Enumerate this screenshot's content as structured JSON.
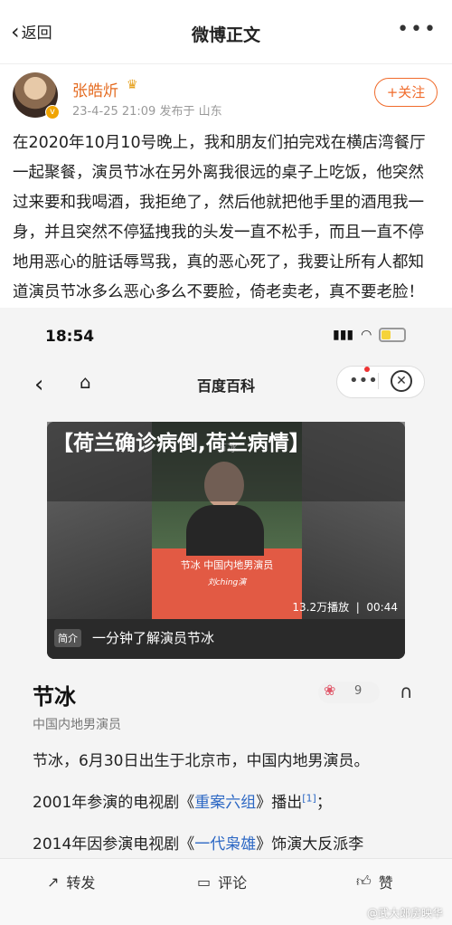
{
  "nav": {
    "back_label": "返回",
    "title": "微博正文",
    "more": "•••"
  },
  "author": {
    "name": "张皓炘",
    "meta": "23-4-25 21:09  发布于 山东",
    "follow_label": "+关注"
  },
  "post_text": "在2020年10月10号晚上，我和朋友们拍完戏在横店湾餐厅一起聚餐，演员节冰在另外离我很远的桌子上吃饭，他突然过来要和我喝酒，我拒绝了，然后他就把他手里的酒甩我一身，并且突然不停猛拽我的头发一直不松手，而且一直不停地用恶心的脏话辱骂我，真的恶心死了，我要让所有人都知道演员节冰多么恶心多么不要脸，倚老卖老，真不要老脸！",
  "screenshot": {
    "time": "18:54",
    "browser_title": "百度百科",
    "video": {
      "frame_caption": "节冰",
      "frame_label": "节冰 中国内地男演员",
      "frame_label2": "刘ching演",
      "plays": "13.2万播放",
      "duration": "00:44",
      "intro_tag": "简介",
      "intro_text": "一分钟了解演员节冰"
    },
    "overlay_title": "【荷兰确诊病倒,荷兰病情】",
    "entry": {
      "name": "节冰",
      "likes": "9",
      "desc": "中国内地男演员",
      "para1": "节冰，6月30日出生于北京市，中国内地男演员。",
      "para2_prefix": "2001年参演的电视剧《",
      "para2_link": "重案六组",
      "para2_suffix": "》播出",
      "para2_ref": "[1]",
      "para2_end": "；",
      "para3_prefix": "2014年因参演电视剧《",
      "para3_link": "一代枭雄",
      "para3_suffix": "》饰演大反派李"
    }
  },
  "actions": {
    "repost": "转发",
    "comment": "评论",
    "like": "赞"
  },
  "watermark": "@武大郎房映华"
}
